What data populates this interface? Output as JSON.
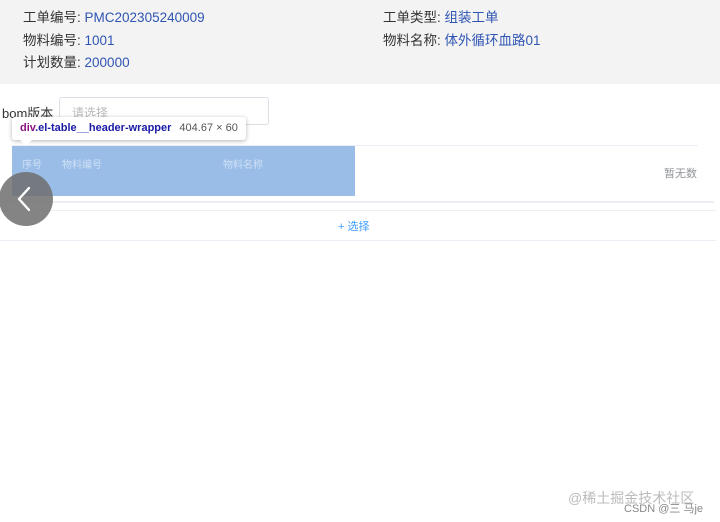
{
  "work_order": {
    "number_label": "工单编号:",
    "number_value": "PMC202305240009",
    "type_label": "工单类型:",
    "type_value": "组装工单",
    "material_code_label": "物料编号:",
    "material_code_value": "1001",
    "material_name_label": "物料名称:",
    "material_name_value": "体外循环血路01",
    "planned_qty_label": "计划数量:",
    "planned_qty_value": "200000"
  },
  "bom": {
    "label": "bom版本",
    "placeholder": "请选择"
  },
  "devtools_tooltip": {
    "tag": "div",
    "class": ".el-table__header-wrapper",
    "size": "404.67 × 60"
  },
  "table": {
    "headers": [
      "序号",
      "物料编号",
      "物料名称"
    ],
    "empty_text": "暂无数"
  },
  "add_button": {
    "label": "+ 选择"
  },
  "watermark": {
    "site": "@稀土掘金技术社区",
    "author": "CSDN @三 马je"
  },
  "colors": {
    "info_value": "#2f55b3",
    "highlight": "#6fa1dd",
    "link": "#409eff"
  }
}
